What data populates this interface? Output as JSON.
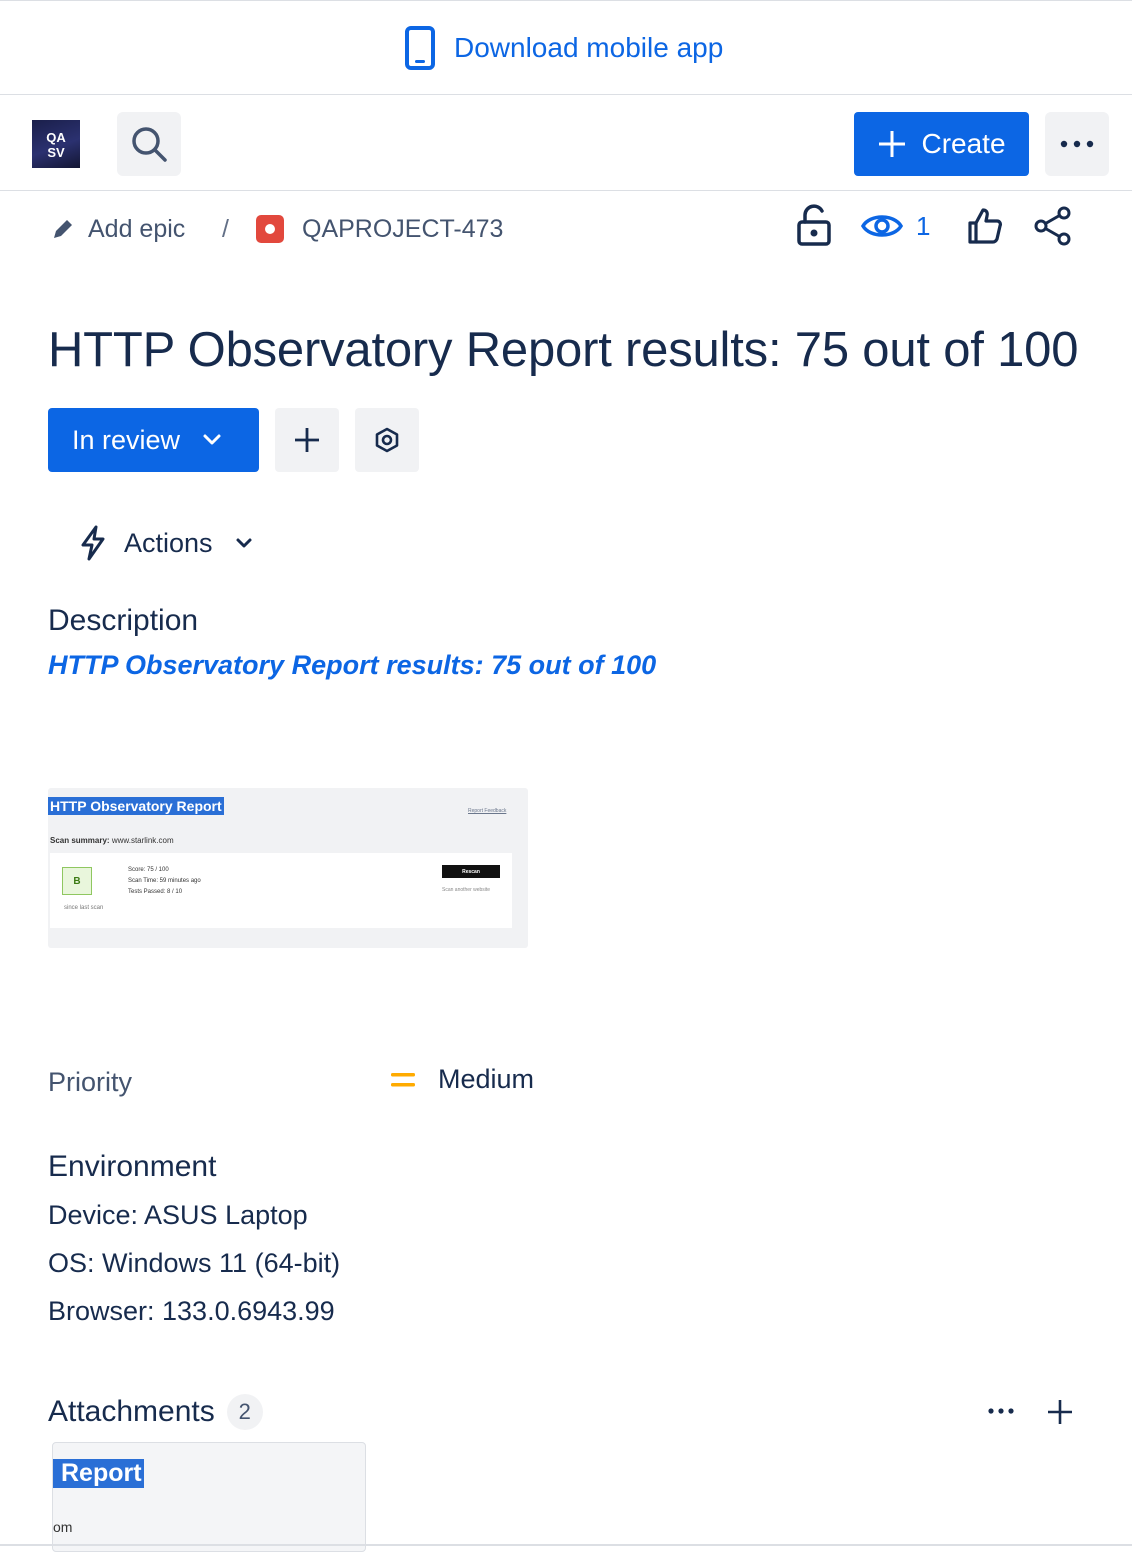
{
  "banner": {
    "label": "Download mobile app"
  },
  "nav": {
    "avatar_text_line1": "QA",
    "avatar_text_line2": "SV",
    "create_label": "Create"
  },
  "breadcrumb": {
    "add_epic": "Add epic",
    "separator": "/",
    "issue_key": "QAPROJECT-473"
  },
  "issue_actions": {
    "watch_count": "1"
  },
  "issue": {
    "title": "HTTP Observatory Report results: 75 out of 100",
    "status": "In review",
    "actions_label": "Actions"
  },
  "description": {
    "heading": "Description",
    "link_text": "HTTP Observatory Report results: 75 out of 100",
    "thumbnail": {
      "title": "HTTP Observatory Report",
      "link": "Report Feedback",
      "summary_label": "Scan summary:",
      "summary_value": "www.starlink.com",
      "grade": "B",
      "score": "Score: 75 / 100",
      "scan_time": "Scan Time: 59 minutes ago",
      "tests_passed": "Tests Passed: 8 / 10",
      "since": "since last scan",
      "rescan": "Rescan",
      "scan_another": "Scan another website"
    }
  },
  "priority": {
    "label": "Priority",
    "value": "Medium",
    "color": "#ffab00"
  },
  "environment": {
    "heading": "Environment",
    "lines": [
      "Device: ASUS Laptop",
      "OS: Windows 11 (64-bit)",
      "Browser: 133.0.6943.99"
    ]
  },
  "attachments": {
    "heading": "Attachments",
    "count": "2",
    "preview_title": "Report",
    "preview_sub": "om"
  },
  "colors": {
    "accent": "#0c66e4",
    "bug": "#e2483d",
    "text": "#172b4d",
    "muted": "#44546f"
  }
}
